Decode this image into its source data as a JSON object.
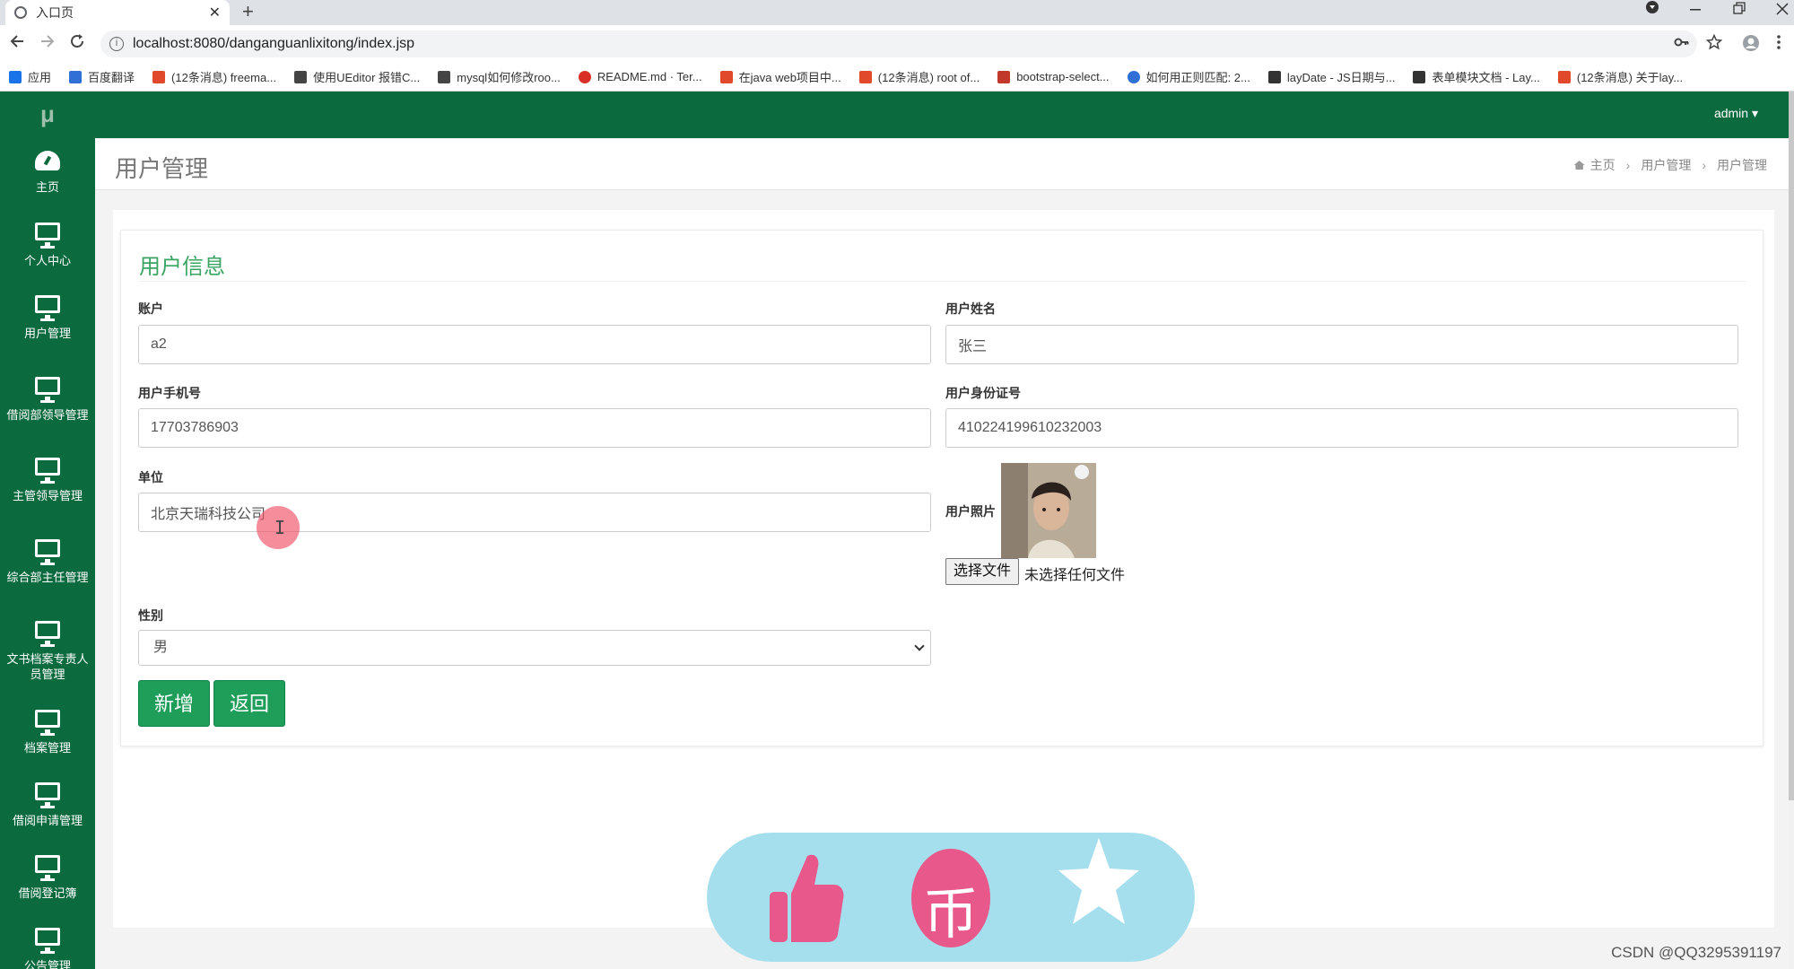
{
  "browser": {
    "tab_title": "入口页",
    "tab_close": "✕",
    "new_tab": "+",
    "url": "localhost:8080/danganguanlixitong/index.jsp",
    "bookmarks": [
      {
        "label": "应用",
        "color": "#1a73e8"
      },
      {
        "label": "百度翻译",
        "color": "#2f6fd6"
      },
      {
        "label": "(12条消息) freema...",
        "color": "#e04a2a"
      },
      {
        "label": "使用UEditor 报错C...",
        "color": "#444444"
      },
      {
        "label": "mysql如何修改roo...",
        "color": "#444444"
      },
      {
        "label": "README.md · Ter...",
        "color": "#d93025"
      },
      {
        "label": "在java web项目中...",
        "color": "#e04a2a"
      },
      {
        "label": "(12条消息) root of...",
        "color": "#e04a2a"
      },
      {
        "label": "bootstrap-select...",
        "color": "#c0392b"
      },
      {
        "label": "如何用正则匹配: 2...",
        "color": "#2f6fd6"
      },
      {
        "label": "layDate - JS日期与...",
        "color": "#333333"
      },
      {
        "label": "表单模块文档 - Lay...",
        "color": "#333333"
      },
      {
        "label": "(12条消息) 关于lay...",
        "color": "#e04a2a"
      }
    ]
  },
  "app": {
    "logo": "μ",
    "user_menu": "admin ▾",
    "sidebar": [
      {
        "label": "主页",
        "icon": "dashboard-icon"
      },
      {
        "label": "个人中心",
        "icon": "monitor-icon"
      },
      {
        "label": "用户管理",
        "icon": "monitor-icon"
      },
      {
        "label": "借阅部领导管理",
        "icon": "monitor-icon"
      },
      {
        "label": "主管领导管理",
        "icon": "monitor-icon"
      },
      {
        "label": "综合部主任管理",
        "icon": "monitor-icon"
      },
      {
        "label": "文书档案专责人员管理",
        "icon": "monitor-icon"
      },
      {
        "label": "档案管理",
        "icon": "monitor-icon"
      },
      {
        "label": "借阅申请管理",
        "icon": "monitor-icon"
      },
      {
        "label": "借阅登记簿",
        "icon": "monitor-icon"
      },
      {
        "label": "公告管理",
        "icon": "monitor-icon"
      }
    ],
    "page_title": "用户管理",
    "breadcrumb": [
      "主页",
      "用户管理",
      "用户管理"
    ],
    "breadcrumb_sep": "›"
  },
  "form": {
    "title": "用户信息",
    "account_label": "账户",
    "account_value": "a2",
    "name_label": "用户姓名",
    "name_value": "张三",
    "phone_label": "用户手机号",
    "phone_value": "17703786903",
    "idcard_label": "用户身份证号",
    "idcard_value": "410224199610232003",
    "unit_label": "单位",
    "unit_value": "北京天瑞科技公司",
    "photo_label": "用户照片",
    "file_button": "选择文件",
    "file_status": "未选择任何文件",
    "gender_label": "性别",
    "gender_value": "男",
    "add_button": "新增",
    "back_button": "返回"
  },
  "overlay": {
    "coin_glyph": "币",
    "watermark": "CSDN @QQ3295391197"
  },
  "colors": {
    "sidebar_green": "#0b6b3f",
    "title_green": "#3aa563",
    "button_green": "#1f9e5a",
    "like_pink": "#e9588a",
    "reaction_bg": "#a5dfee"
  }
}
